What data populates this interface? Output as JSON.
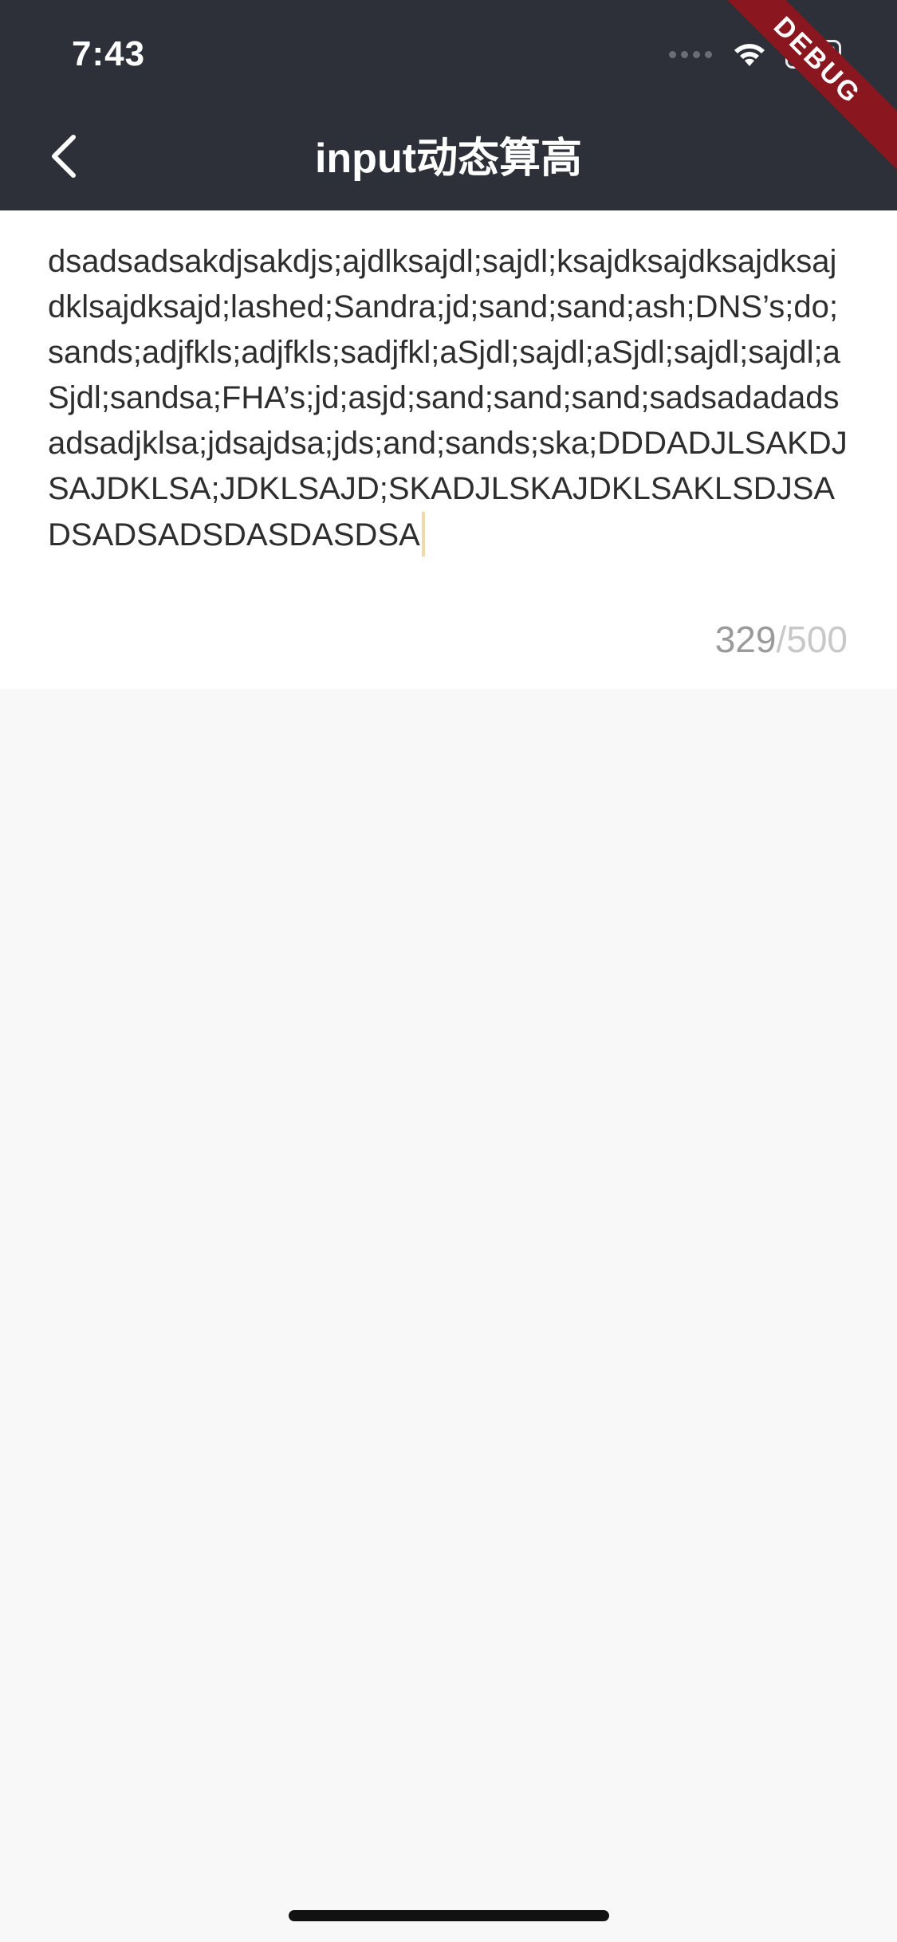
{
  "status_bar": {
    "time": "7:43",
    "icons": [
      "signal-dots-icon",
      "wifi-icon",
      "battery-icon"
    ]
  },
  "debug_banner": "DEBUG",
  "nav": {
    "back_icon": "chevron-left-icon",
    "title": "input动态算高"
  },
  "input": {
    "value": "dsadsadsakdjsakdjs;ajdlksajdl;sajdl;ksajdksajdksajdksajdklsajdksajd;lashed;Sandra;jd;sand;sand;ash;DNS’s;do;sands;adjfkls;adjfkls;sadjfkl;aSjdl;sajdl;aSjdl;sajdl;sajdl;aSjdl;sandsa;FHA’s;jd;asjd;sand;sand;sand;sadsadadadsadsadjklsa;jdsajdsa;jds;and;sands;ska;DDDADJLSAKDJSAJDKLSA;JDKLSAJD;SKADJLSKAJDKLSAKLSDJSADSADSADSDASDASDSA",
    "counter_current": "329",
    "counter_separator": "/",
    "counter_max": "500"
  },
  "colors": {
    "header_bg": "#2e3039",
    "page_bg": "#f8f8f8",
    "card_bg": "#ffffff",
    "text": "#2e2e2e",
    "counter_current": "#9a9a9a",
    "counter_max": "#c8c8c8",
    "cursor": "#f1d9a5",
    "debug_ribbon": "#8a1620"
  }
}
